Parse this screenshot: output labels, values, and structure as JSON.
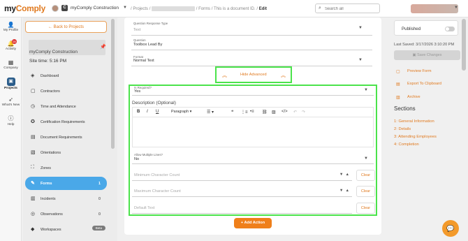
{
  "brand": {
    "name_prefix": "my",
    "name_main": "Comply"
  },
  "header": {
    "org_logo": "C",
    "org_name": "myComply Construction",
    "crumb_projects": "Projects",
    "crumb_forms": "Forms",
    "crumb_doc": "This is a document ID.",
    "crumb_current": "Edit",
    "search_placeholder": "Search all"
  },
  "rail": [
    {
      "label": "My Profile",
      "icon": "user-icon"
    },
    {
      "label": "Activity",
      "icon": "bell-icon",
      "badge": "26"
    },
    {
      "label": "Company",
      "icon": "building-icon"
    },
    {
      "label": "Projects",
      "icon": "projects-icon"
    },
    {
      "label": "What's New",
      "icon": "rocket-icon"
    },
    {
      "label": "Help",
      "icon": "help-icon"
    }
  ],
  "project": {
    "back_label": "Back to Projects",
    "name": "myComply Construction",
    "site_time": "Site time: 5:16 PM",
    "nav": [
      {
        "label": "Dashboard",
        "icon": "dashboard-icon",
        "count": ""
      },
      {
        "label": "Contractors",
        "icon": "briefcase-icon",
        "count": ""
      },
      {
        "label": "Time and Attendance",
        "icon": "clock-icon",
        "count": ""
      },
      {
        "label": "Certification Requirements",
        "icon": "certificate-icon",
        "count": ""
      },
      {
        "label": "Document Requirements",
        "icon": "document-icon",
        "count": ""
      },
      {
        "label": "Orientations",
        "icon": "orientation-icon",
        "count": ""
      },
      {
        "label": "Zones",
        "icon": "zones-icon",
        "count": ""
      },
      {
        "label": "Forms",
        "icon": "pencil-icon",
        "count": "1"
      },
      {
        "label": "Incidents",
        "icon": "incident-icon",
        "count": "0"
      },
      {
        "label": "Observations",
        "icon": "observation-icon",
        "count": "0"
      },
      {
        "label": "Workspaces",
        "icon": "layers-icon",
        "count": "",
        "badge": "Beta"
      }
    ]
  },
  "form": {
    "response_type_label": "Question Response Type",
    "response_type_value": "Text",
    "question_label": "Question",
    "question_value": "Toolbox Lead By",
    "format_label": "Format",
    "format_value": "Normal Text",
    "hide_advanced": "Hide Advanced",
    "is_required_label": "Is Required?",
    "is_required_value": "Yes",
    "description_title": "Description (Optional)",
    "paragraph_label": "Paragraph",
    "allow_multiple_label": "Allow Multiple Lines?",
    "allow_multiple_value": "No",
    "min_placeholder": "Minimum Character Count",
    "max_placeholder": "Maximum Character Count",
    "default_placeholder": "Default Text",
    "clear_label": "Clear",
    "add_action_label": "+ Add Action"
  },
  "right": {
    "published_label": "Published",
    "published_on": false,
    "last_saved": "Last Saved: 3/17/2026 3:10:20 PM",
    "save_label": "Save Changes",
    "preview_label": "Preview Form",
    "export_label": "Export To Clipboard",
    "archive_label": "Archive",
    "sections_title": "Sections",
    "sections": [
      "1: General Information",
      "2: Details",
      "3: Attending Employees",
      "4: Completion"
    ]
  },
  "colors": {
    "accent": "#e07a20",
    "active_nav": "#4aa8e8",
    "highlight": "#4be34b"
  }
}
